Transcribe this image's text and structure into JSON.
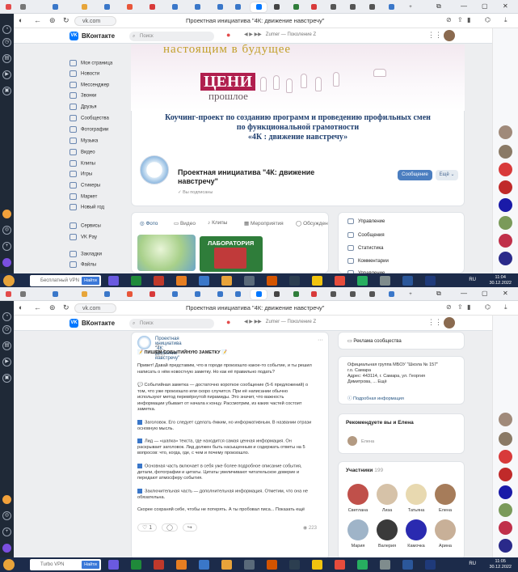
{
  "top": {
    "browser": {
      "url": "vk.com",
      "title": "Проектная инициатива \"4К: движение навстречу\"",
      "window_controls": [
        "—",
        "▢",
        "✕"
      ],
      "tab_label": "ВКонтакте"
    },
    "vk": {
      "brand": "ВКонтакте",
      "logo_text": "VK",
      "search_placeholder": "Поиск",
      "player_text": "Zumer — Поколение Z",
      "menu": [
        "Моя страница",
        "Новости",
        "Мессенджер",
        "Звонки",
        "Друзья",
        "Сообщества",
        "Фотографии",
        "Музыка",
        "Видео",
        "Клипы",
        "Игры",
        "Стикеры",
        "Маркет",
        "Новый год",
        "Сервисы",
        "VK Pay",
        "Закладки",
        "Файлы"
      ]
    },
    "banner": {
      "line1": "настоящим в будущее",
      "line2": "ЦЕНИ",
      "line3": "прошлое",
      "title_lines": [
        "Коучинг-проект по созданию программ и проведению профильных смен",
        "по функциональной грамотности",
        "«4К : движение навстречу»"
      ]
    },
    "community": {
      "name_line1": "Проектная инициатива \"4К: движение",
      "name_line2": "навстречу\"",
      "subscribed": "Вы подписаны",
      "message_button": "Сообщение",
      "more_button": "Ещё"
    },
    "tabs": [
      "Фото",
      "Видео",
      "Клипы",
      "Мероприятия",
      "Обсужден"
    ],
    "photo_caption": "ЛАБОРАТОРИЯ",
    "side_menu": [
      "Управление",
      "Сообщения",
      "Статистика",
      "Комментарии",
      "Управление"
    ],
    "taskbar": {
      "search_text": "Бесплатный VPN",
      "search_button": "Найти",
      "lang": "RU",
      "time": "11:04",
      "date": "30.12.2022"
    }
  },
  "bottom": {
    "browser": {
      "url": "vk.com",
      "title": "Проектная инициатива \"4К: движение навстречу\""
    },
    "vk": {
      "brand": "ВКонтакте",
      "logo_text": "VK",
      "search_placeholder": "Поиск",
      "player_text": "Zumer — Поколение Z"
    },
    "post": {
      "author": "Проектная инициатива \"4К: движение навстречу\"",
      "date": "26 апр в 15:57",
      "heading": "📝 ПИШЕМ СОБЫТИЙНУЮ ЗАМЕТКУ 📝",
      "paragraphs": [
        [
          "Привет! Давай представим, что в городе произошло какое-то событие, и ты решил",
          "написать о нём новостную заметку. Но как её правильно подать?"
        ],
        [
          "💬 Событийная заметка — достаточно короткое сообщение (5-6 предложений) о",
          "том, что уже произошло или скоро случится. При её написании обычно",
          "используют метод перевёрнутой пирамиды. Это значит, что важность",
          "информации убывает от начала к концу. Рассмотрим, из каких частей состоит",
          "заметка."
        ],
        [
          "Заголовок. Его следует сделать ёмким, но информативным. В названии отрази",
          "основную мысль."
        ],
        [
          "Лид — «шапка» текста, где находится самая ценная информация. Он",
          "раскрывает заголовок. Лид должен быть насыщенным и содержать ответы на 5",
          "вопросов: что, когда, где, с чем и почему произошло."
        ],
        [
          "Основная часть включает в себя уже более подробное описание события,",
          "детали, фотографии и цитаты. Цитаты увеличивают читательское доверие и",
          "передают атмосферу события."
        ],
        [
          "Заключительная часть — дополнительная информация. Отметим, что она не",
          "обязательна."
        ],
        [
          "Скорее сохраняй себе, чтобы не потерять. А ты пробовал писа...  Показать ещё"
        ]
      ],
      "likes": "1",
      "views": "223"
    },
    "right": {
      "ads": "Реклама сообщества",
      "address_lines": [
        "Официальная группа МБОУ \"Школа № 157\"",
        "г.о. Самара",
        "Адрес: 443114, г. Самара, ул. Георгия",
        "Димитрова, ... Ещё"
      ],
      "more_info": "Подробная информация",
      "recommend_title": "Рекомендуете вы и Елена",
      "recommend_name": "Елена",
      "members_title": "Участники",
      "members_count": "199",
      "members": [
        "Светлана",
        "Лиза",
        "Татьяна",
        "Елена",
        "Мария",
        "Валерия",
        "Камочка",
        "Арина"
      ]
    },
    "taskbar": {
      "search_text": "Turbo VPN",
      "search_button": "Найти",
      "lang": "RU",
      "time": "11:05",
      "date": "30.12.2022"
    }
  },
  "colors": {
    "vk_blue": "#0077ff",
    "link": "#2a5885",
    "button": "#4b7ec0",
    "banner_red": "#b01f4e",
    "taskbar": "#1c2b4a"
  }
}
